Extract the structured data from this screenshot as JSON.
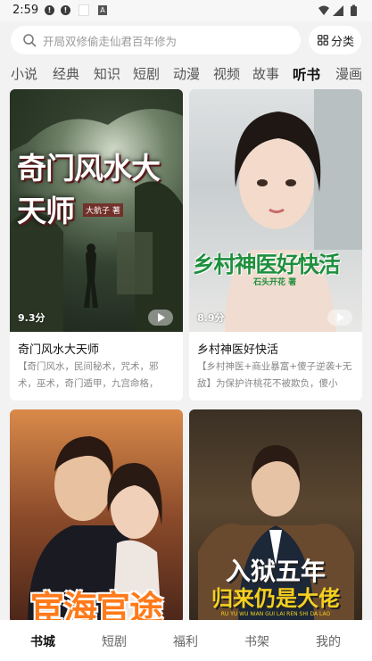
{
  "status_bar": {
    "time": "2:59",
    "notif1": "!",
    "notif2": "!",
    "notif4": "A"
  },
  "search": {
    "placeholder": "开局双修偷走仙君百年修为",
    "category_label": "分类"
  },
  "tabs": [
    "小说",
    "经典",
    "知识",
    "短剧",
    "动漫",
    "视频",
    "故事",
    "听书",
    "漫画"
  ],
  "active_tab": "听书",
  "books": [
    {
      "title": "奇门风水大天师",
      "score": "9.3分",
      "desc": "【奇门风水，民间秘术，咒术，邪术，巫术，奇门遁甲，九宫命格，",
      "cover_title": "奇门风水大天师",
      "cover_author": "大航子 著"
    },
    {
      "title": "乡村神医好快活",
      "score": "8.9分",
      "desc": "【乡村神医+商业暴富+傻子逆袭+无敌】为保护许桃花不被欺负，傻小",
      "cover_title": "乡村神医好快活",
      "cover_author": "石头开花 著"
    },
    {
      "title": "宦海官途",
      "cover_title": "宦海官途"
    },
    {
      "title": "入狱五年归来仍是大佬",
      "cover_title_line1": "入狱五年",
      "cover_title_line2": "归来仍是大佬",
      "cover_subtitle": "RU YU WU NIAN GUI LAI REN SHI DA LAO"
    }
  ],
  "bottom_nav": [
    "书城",
    "短剧",
    "福利",
    "书架",
    "我的"
  ],
  "active_nav": "书城",
  "colors": {
    "accent": "#111111",
    "background": "#f2f2f2",
    "green_title": "#1e8f3c"
  }
}
